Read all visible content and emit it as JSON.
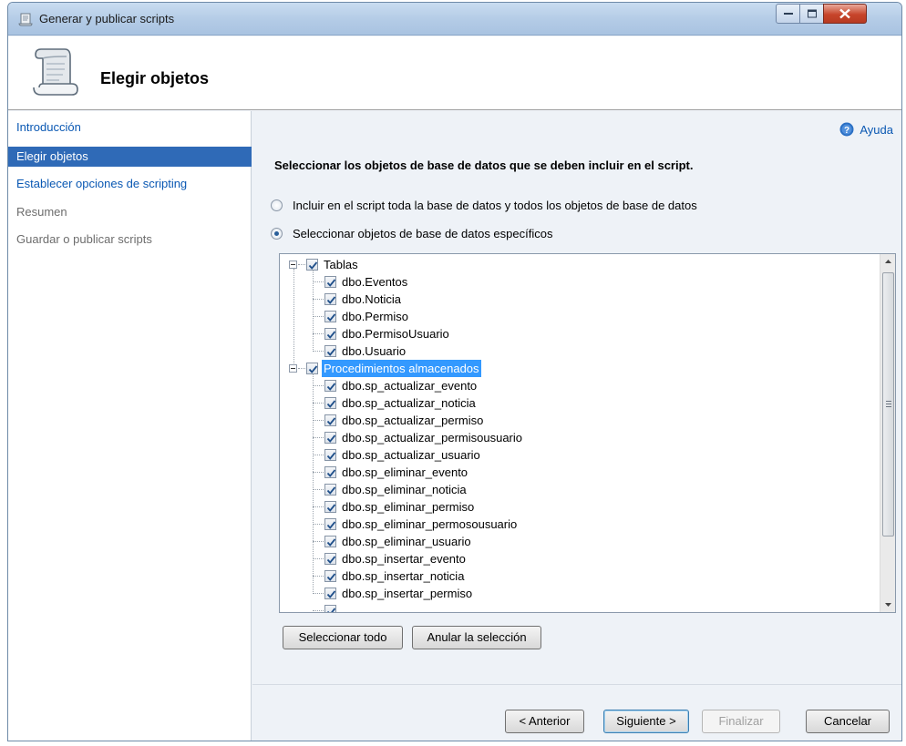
{
  "window": {
    "title": "Generar y publicar scripts",
    "header_title": "Elegir objetos"
  },
  "sidebar": {
    "items": [
      {
        "label": "Introducción",
        "state": "link"
      },
      {
        "label": "Elegir objetos",
        "state": "selected"
      },
      {
        "label": "Establecer opciones de scripting",
        "state": "link"
      },
      {
        "label": "Resumen",
        "state": "disabled"
      },
      {
        "label": "Guardar o publicar scripts",
        "state": "disabled"
      }
    ]
  },
  "main": {
    "help_label": "Ayuda",
    "instruction": "Seleccionar los objetos de base de datos que se deben incluir en el script.",
    "option_all": "Incluir en el script toda la base de datos y todos los objetos de base de datos",
    "option_specific": "Seleccionar objetos de base de datos específicos",
    "selected_option": "specific"
  },
  "tree": {
    "groups": [
      {
        "label": "Tablas",
        "checked": true,
        "highlighted": false,
        "items": [
          "dbo.Eventos",
          "dbo.Noticia",
          "dbo.Permiso",
          "dbo.PermisoUsuario",
          "dbo.Usuario"
        ]
      },
      {
        "label": "Procedimientos almacenados",
        "checked": true,
        "highlighted": true,
        "items": [
          "dbo.sp_actualizar_evento",
          "dbo.sp_actualizar_noticia",
          "dbo.sp_actualizar_permiso",
          "dbo.sp_actualizar_permisousuario",
          "dbo.sp_actualizar_usuario",
          "dbo.sp_eliminar_evento",
          "dbo.sp_eliminar_noticia",
          "dbo.sp_eliminar_permiso",
          "dbo.sp_eliminar_permosousuario",
          "dbo.sp_eliminar_usuario",
          "dbo.sp_insertar_evento",
          "dbo.sp_insertar_noticia",
          "dbo.sp_insertar_permiso"
        ]
      }
    ]
  },
  "buttons": {
    "select_all": "Seleccionar todo",
    "clear_selection": "Anular la selección",
    "previous": "< Anterior",
    "next": "Siguiente >",
    "finish": "Finalizar",
    "cancel": "Cancelar"
  },
  "colors": {
    "selection": "#2f6ab7",
    "link": "#0a58b3",
    "highlight": "#3399ff"
  }
}
